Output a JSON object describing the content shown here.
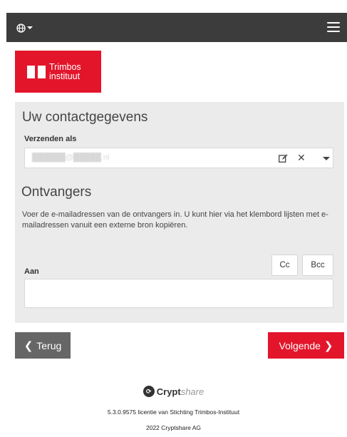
{
  "logo": {
    "line1": "Trimbos",
    "line2": "instituut"
  },
  "contact": {
    "heading": "Uw contactgegevens",
    "sender_label": "Verzenden als",
    "sender_value": "██████@█████.nl"
  },
  "recipients": {
    "heading": "Ontvangers",
    "description": "Voer de e-mailadressen van de ontvangers in. U kunt hier via het klembord lijsten met e-mailadressen vanuit een externe bron kopiëren.",
    "cc_label": "Cc",
    "bcc_label": "Bcc",
    "to_label": "Aan",
    "to_value": ""
  },
  "nav": {
    "back_label": "Terug",
    "next_label": "Volgende"
  },
  "footer": {
    "brand_bold": "Crypt",
    "brand_italic": "share",
    "license": "5.3.0.9575 licentie van Stichting Trimbos-Instituut",
    "copyright": "2022 Cryptshare AG"
  },
  "colors": {
    "accent": "#e3152b",
    "topbar": "#3c3c3c",
    "panel": "#ebebeb",
    "back_button": "#666666"
  }
}
